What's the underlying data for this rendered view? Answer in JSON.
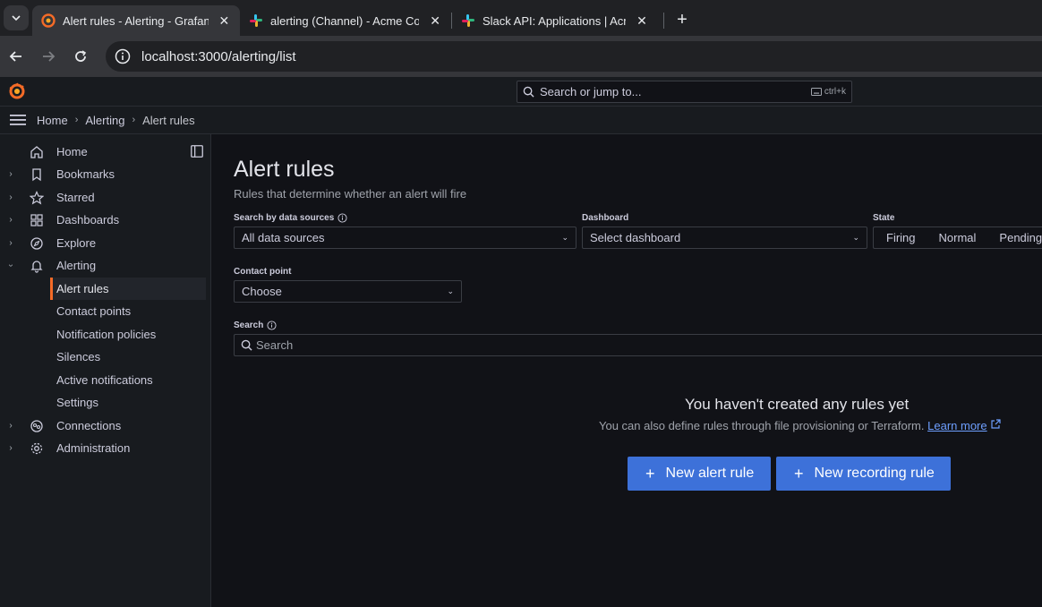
{
  "browser": {
    "tabs": [
      {
        "title": "Alert rules - Alerting - Grafana",
        "active": true,
        "icon": "grafana-icon"
      },
      {
        "title": "alerting (Channel) - Acme Co - S",
        "active": false,
        "icon": "slack-icon"
      },
      {
        "title": "Slack API: Applications | Acme C",
        "active": false,
        "icon": "slack-icon"
      }
    ],
    "url": "localhost:3000/alerting/list"
  },
  "topbar": {
    "search_placeholder": "Search or jump to...",
    "shortcut": "ctrl+k"
  },
  "breadcrumb": [
    "Home",
    "Alerting",
    "Alert rules"
  ],
  "sidebar": {
    "items": [
      {
        "label": "Home",
        "icon": "home-icon",
        "expandable": false
      },
      {
        "label": "Bookmarks",
        "icon": "bookmark-icon",
        "expandable": true
      },
      {
        "label": "Starred",
        "icon": "star-icon",
        "expandable": true
      },
      {
        "label": "Dashboards",
        "icon": "dashboards-icon",
        "expandable": true
      },
      {
        "label": "Explore",
        "icon": "compass-icon",
        "expandable": true
      },
      {
        "label": "Alerting",
        "icon": "bell-icon",
        "expandable": true,
        "expanded": true
      },
      {
        "label": "Connections",
        "icon": "connections-icon",
        "expandable": true
      },
      {
        "label": "Administration",
        "icon": "gear-icon",
        "expandable": true
      }
    ],
    "alerting_children": [
      "Alert rules",
      "Contact points",
      "Notification policies",
      "Silences",
      "Active notifications",
      "Settings"
    ],
    "active_child": "Alert rules"
  },
  "main": {
    "title": "Alert rules",
    "subtitle": "Rules that determine whether an alert will fire",
    "filters": {
      "datasource_label": "Search by data sources",
      "datasource_value": "All data sources",
      "dashboard_label": "Dashboard",
      "dashboard_value": "Select dashboard",
      "state_label": "State",
      "state_options": [
        "Firing",
        "Normal",
        "Pending"
      ],
      "contact_label": "Contact point",
      "contact_value": "Choose",
      "search_label": "Search",
      "search_placeholder": "Search"
    },
    "empty": {
      "title": "You haven't created any rules yet",
      "desc": "You can also define rules through file provisioning or Terraform.",
      "link": "Learn more"
    },
    "buttons": {
      "new_alert": "New alert rule",
      "new_recording": "New recording rule"
    }
  },
  "colors": {
    "accent": "#f46b27",
    "primary_button": "#3d71d9",
    "link": "#6e9fff"
  }
}
